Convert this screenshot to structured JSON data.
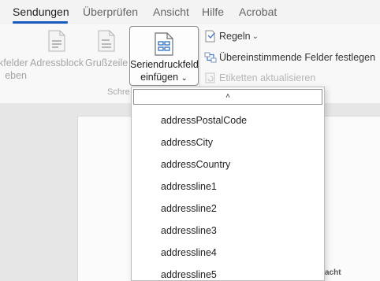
{
  "tabs": [
    {
      "label": "Sendungen",
      "active": true
    },
    {
      "label": "Überprüfen",
      "active": false
    },
    {
      "label": "Ansicht",
      "active": false
    },
    {
      "label": "Hilfe",
      "active": false
    },
    {
      "label": "Acrobat",
      "active": false
    }
  ],
  "ribbon": {
    "partial_left": {
      "line1": "kfelder",
      "line2": "eben"
    },
    "address_block": "Adressblock",
    "greeting_line": "Grußzeile",
    "insert_merge_field": {
      "line1": "Seriendruckfeld",
      "line2": "einfügen",
      "chevron": "⌄"
    },
    "rules": "Regeln",
    "rules_chevron": "⌄",
    "match_fields": "Übereinstimmende Felder festlegen",
    "update_labels": "Etiketten aktualisieren",
    "group_label": "Schre"
  },
  "dropdown": {
    "scroll_up_glyph": "˄",
    "items": [
      "addressPostalCode",
      "addressCity",
      "addressCountry",
      "addressline1",
      "addressline2",
      "addressline3",
      "addressline4",
      "addressline5"
    ]
  },
  "document": {
    "partial_text": "acht"
  },
  "colors": {
    "accent": "#185abd",
    "ribbon_bg": "#f8f8f8",
    "doc_bg": "#e6e6e6"
  }
}
